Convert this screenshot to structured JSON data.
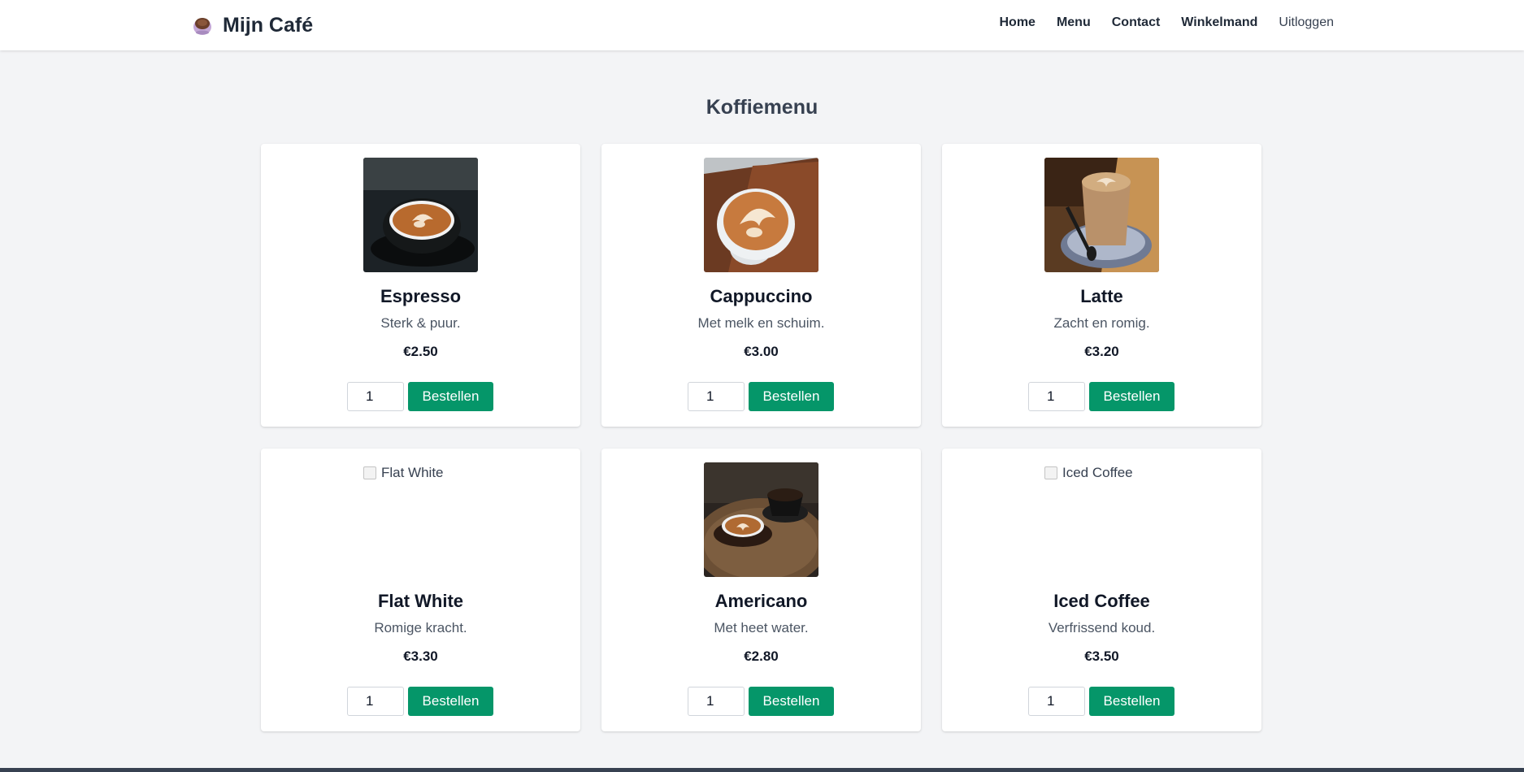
{
  "header": {
    "brand": "Mijn Café",
    "brand_icon": "coffee-cup-icon",
    "nav": [
      "Home",
      "Menu",
      "Contact",
      "Winkelmand",
      "Uitloggen"
    ]
  },
  "main": {
    "title": "Koffiemenu"
  },
  "colors": {
    "accent": "#059669",
    "background": "#f3f4f6"
  },
  "products": [
    {
      "name": "Espresso",
      "description": "Sterk & puur.",
      "price": "€2.50",
      "quantity": "1",
      "button": "Bestellen",
      "image_alt": "Espresso",
      "image_loaded": true
    },
    {
      "name": "Cappuccino",
      "description": "Met melk en schuim.",
      "price": "€3.00",
      "quantity": "1",
      "button": "Bestellen",
      "image_alt": "Cappuccino",
      "image_loaded": true
    },
    {
      "name": "Latte",
      "description": "Zacht en romig.",
      "price": "€3.20",
      "quantity": "1",
      "button": "Bestellen",
      "image_alt": "Latte",
      "image_loaded": true
    },
    {
      "name": "Flat White",
      "description": "Romige kracht.",
      "price": "€3.30",
      "quantity": "1",
      "button": "Bestellen",
      "image_alt": "Flat White",
      "image_loaded": false
    },
    {
      "name": "Americano",
      "description": "Met heet water.",
      "price": "€2.80",
      "quantity": "1",
      "button": "Bestellen",
      "image_alt": "Americano",
      "image_loaded": true
    },
    {
      "name": "Iced Coffee",
      "description": "Verfrissend koud.",
      "price": "€3.50",
      "quantity": "1",
      "button": "Bestellen",
      "image_alt": "Iced Coffee",
      "image_loaded": false
    }
  ]
}
